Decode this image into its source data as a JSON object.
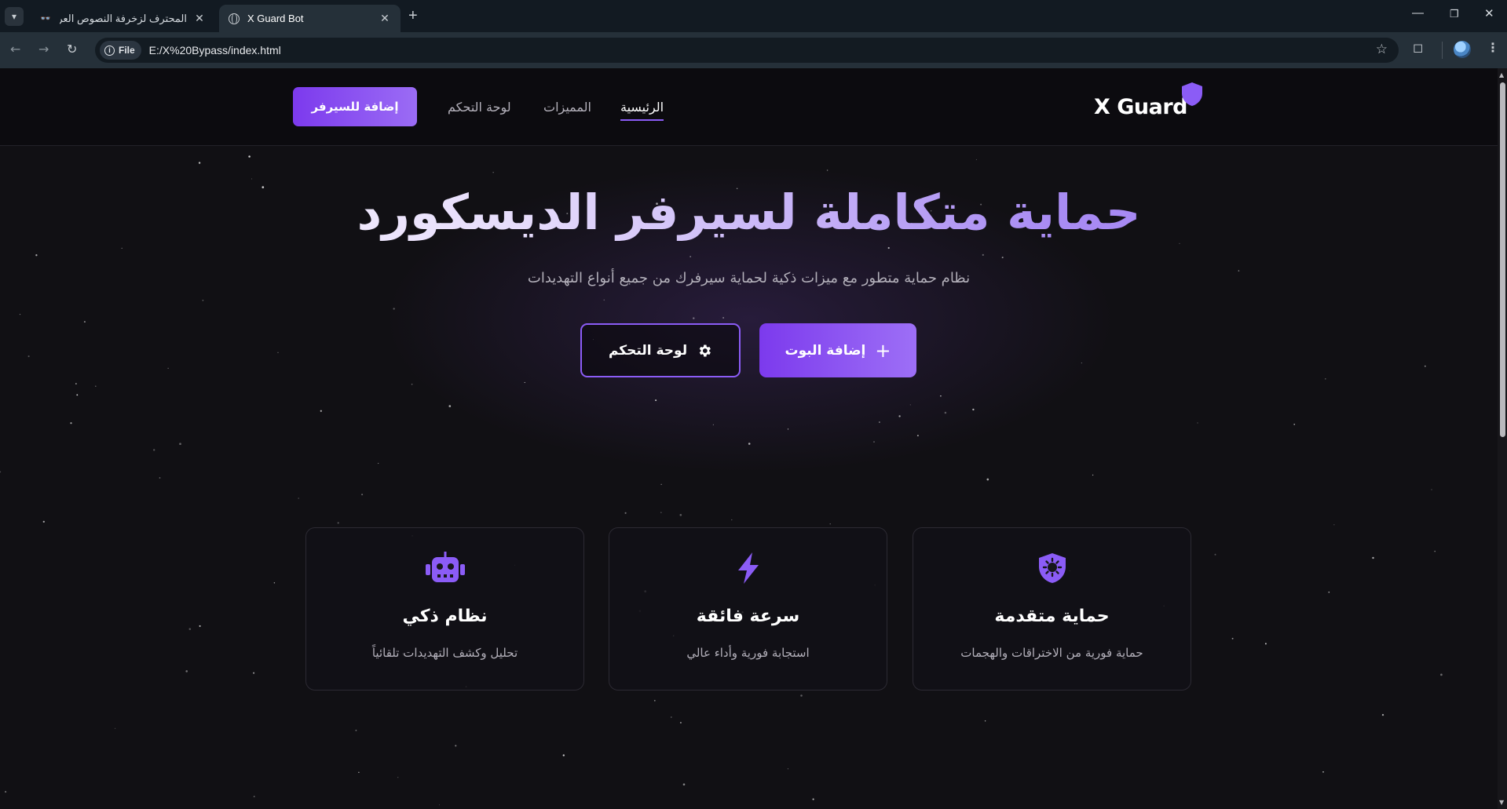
{
  "browser": {
    "tabs": [
      {
        "title": "المحترف لزخرفة النصوص العربية",
        "favicon": "glasses-icon",
        "active": false
      },
      {
        "title": "X Guard Bot",
        "favicon": "globe-icon",
        "active": true
      }
    ],
    "url_chip": "File",
    "url": "E:/X%20Bypass/index.html"
  },
  "site": {
    "brand": "X Guard",
    "accent_color": "#8b5cf6",
    "nav": [
      {
        "label": "الرئيسية",
        "active": true
      },
      {
        "label": "المميزات",
        "active": false
      },
      {
        "label": "لوحة التحكم",
        "active": false
      }
    ],
    "header_button": "إضافة للسيرفر"
  },
  "hero": {
    "title": "حماية متكاملة لسيرفر الديسكورد",
    "subtitle": "نظام حماية متطور مع ميزات ذكية لحماية سيرفرك من جميع أنواع التهديدات",
    "primary_button": "إضافة البوت",
    "secondary_button": "لوحة التحكم"
  },
  "features": [
    {
      "icon": "shield-virus-icon",
      "title": "حماية متقدمة",
      "description": "حماية فورية من الاختراقات والهجمات"
    },
    {
      "icon": "bolt-icon",
      "title": "سرعة فائقة",
      "description": "استجابة فورية وأداء عالي"
    },
    {
      "icon": "robot-icon",
      "title": "نظام ذكي",
      "description": "تحليل وكشف التهديدات تلقائياً"
    }
  ]
}
